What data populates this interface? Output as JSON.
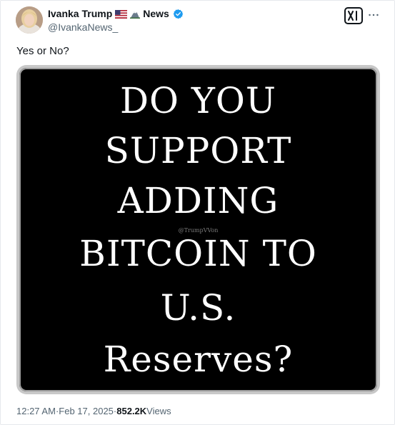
{
  "author": {
    "display_name": "Ivanka Trump",
    "name_suffix": "News",
    "handle": "@IvankaNews_",
    "flag_emoji_icon": "us-flag-icon",
    "mountain_emoji_icon": "mountain-icon",
    "verified_color": "#1d9bf0"
  },
  "tweet": {
    "text": "Yes or No?",
    "image": {
      "lines": [
        "DO YOU",
        "SUPPORT",
        "ADDING",
        "BITCOIN TO",
        "U.S.",
        "Reserves?"
      ],
      "watermark": "@TrumpVVon"
    },
    "time": "12:27 AM",
    "separator": " · ",
    "date": "Feb 17, 2025",
    "views_count": "852.2K",
    "views_label": " Views"
  },
  "icons": {
    "grok": "grok-icon",
    "more": "more-dots-icon"
  }
}
